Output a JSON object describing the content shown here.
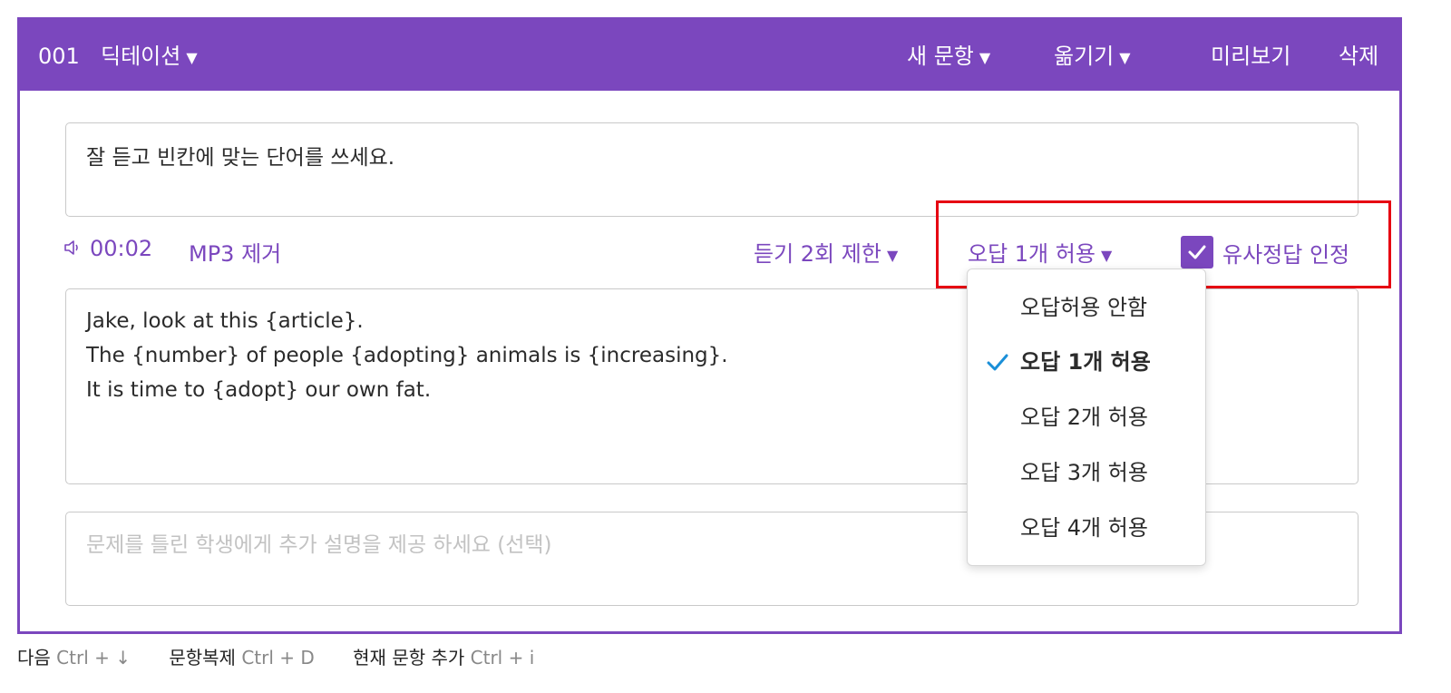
{
  "header": {
    "number": "001",
    "question_type": "딕테이션",
    "new_question": "새 문항",
    "move": "옮기기",
    "preview": "미리보기",
    "delete": "삭제"
  },
  "instruction_text": "잘 듣고 빈칸에 맞는 단어를 쓰세요.",
  "tools": {
    "audio_time": "00:02",
    "remove_mp3": "MP3 제거",
    "listen_limit": "듣기 2회 제한",
    "wrong_answers": "오답 1개 허용",
    "similar_answer": "유사정답 인정",
    "similar_checked": true
  },
  "answer_lines": [
    "Jake, look at this {article}.",
    "The {number} of people {adopting} animals is {increasing}.",
    "It is time to {adopt} our own fat."
  ],
  "feedback_placeholder": "문제를 틀린 학생에게 추가 설명을 제공 하세요 (선택)",
  "dropdown": {
    "options": [
      "오답허용 안함",
      "오답 1개 허용",
      "오답 2개 허용",
      "오답 3개 허용",
      "오답 4개 허용"
    ],
    "selected_index": 1
  },
  "shortcuts": [
    {
      "label": "다음",
      "key": "Ctrl + ↓"
    },
    {
      "label": "문항복제",
      "key": "Ctrl + D"
    },
    {
      "label": "현재 문항 추가",
      "key": "Ctrl + i"
    }
  ],
  "colors": {
    "accent": "#7b47be",
    "highlight": "#e60012",
    "check": "#1a8fd8"
  }
}
